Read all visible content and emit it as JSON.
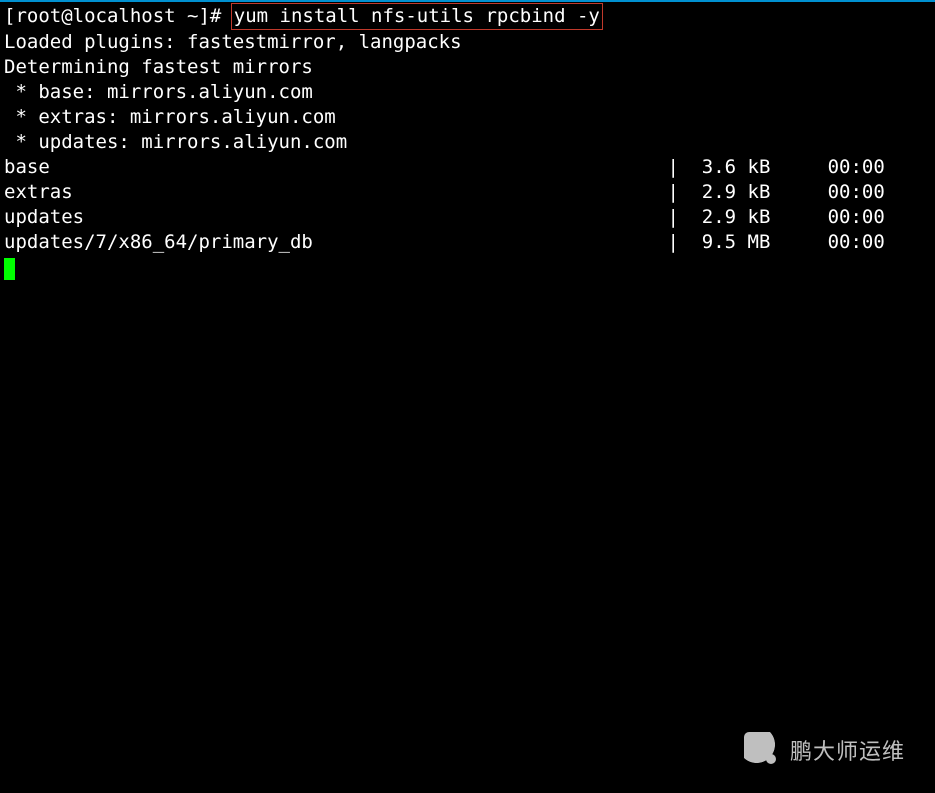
{
  "prompt": "[root@localhost ~]# ",
  "command": "yum install nfs-utils rpcbind -y",
  "output_lines": [
    "Loaded plugins: fastestmirror, langpacks",
    "Determining fastest mirrors",
    " * base: mirrors.aliyun.com",
    " * extras: mirrors.aliyun.com",
    " * updates: mirrors.aliyun.com"
  ],
  "repos": [
    {
      "name": "base",
      "size": "3.6 kB",
      "time": "00:00"
    },
    {
      "name": "extras",
      "size": "2.9 kB",
      "time": "00:00"
    },
    {
      "name": "updates",
      "size": "2.9 kB",
      "time": "00:00"
    },
    {
      "name": "updates/7/x86_64/primary_db",
      "size": "9.5 MB",
      "time": "00:00"
    }
  ],
  "col_name_width": 58,
  "col_size_width": 7,
  "col_time_pad": 5,
  "watermark": "鹏大师运维"
}
